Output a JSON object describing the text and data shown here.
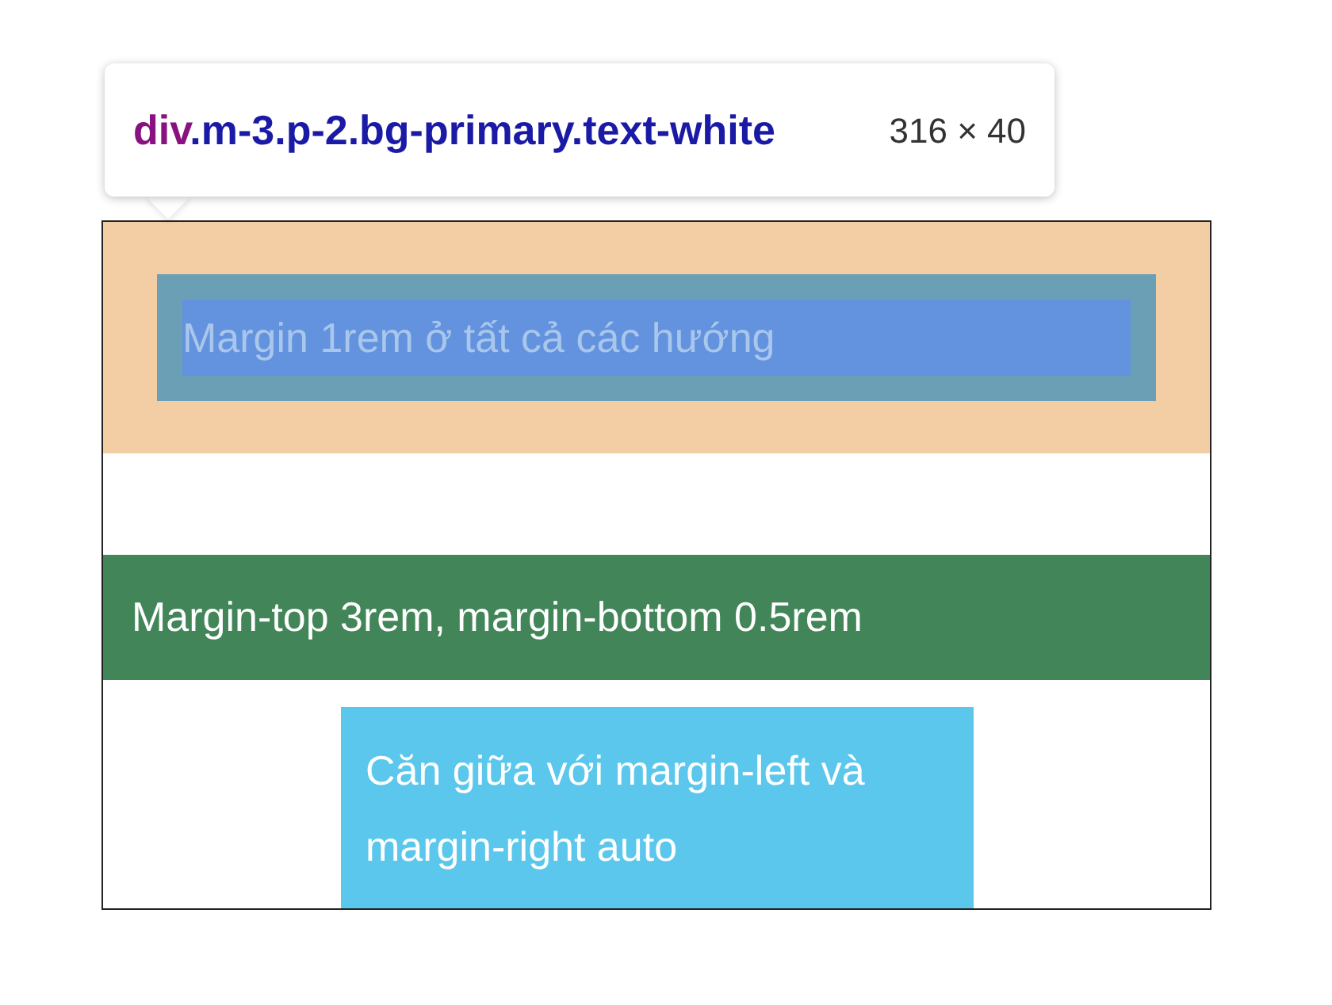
{
  "tooltip": {
    "tag": "div",
    "classes": ".m-3.p-2.bg-primary.text-white",
    "size": "316 × 40"
  },
  "blocks": [
    {
      "kind": "inspected",
      "text": "Margin 1rem ở tất cả các hướng"
    },
    {
      "kind": "wide",
      "color": "#418558",
      "text": "Margin-top 3rem, margin-bottom 0.5rem"
    },
    {
      "kind": "centered",
      "color": "#5bc7ec",
      "text": "Căn giữa với margin-left và margin-right auto"
    }
  ]
}
